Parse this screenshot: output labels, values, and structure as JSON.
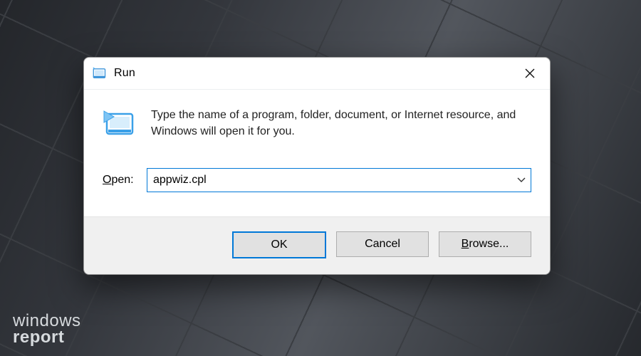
{
  "dialog": {
    "title": "Run",
    "description": "Type the name of a program, folder, document, or Internet resource, and Windows will open it for you.",
    "open_label_letter": "O",
    "open_label_rest": "pen:",
    "input_value": "appwiz.cpl",
    "buttons": {
      "ok": "OK",
      "cancel": "Cancel",
      "browse_letter": "B",
      "browse_rest": "rowse..."
    }
  },
  "watermark": {
    "line1": "windows",
    "line2": "report"
  }
}
